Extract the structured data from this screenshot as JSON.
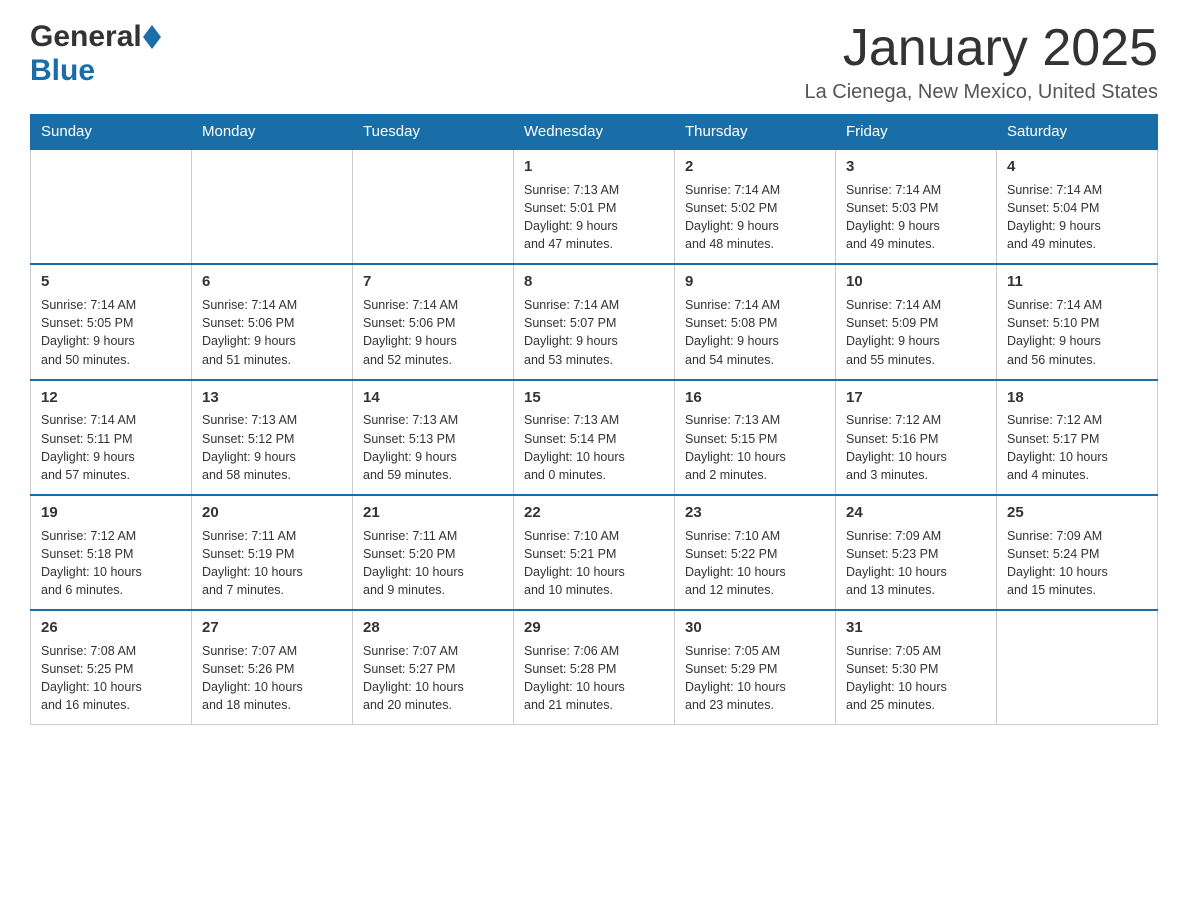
{
  "header": {
    "logo_general": "General",
    "logo_blue": "Blue",
    "logo_tagline": "Blue",
    "month_title": "January 2025",
    "location": "La Cienega, New Mexico, United States"
  },
  "weekdays": [
    "Sunday",
    "Monday",
    "Tuesday",
    "Wednesday",
    "Thursday",
    "Friday",
    "Saturday"
  ],
  "weeks": [
    [
      {
        "day": "",
        "info": ""
      },
      {
        "day": "",
        "info": ""
      },
      {
        "day": "",
        "info": ""
      },
      {
        "day": "1",
        "info": "Sunrise: 7:13 AM\nSunset: 5:01 PM\nDaylight: 9 hours\nand 47 minutes."
      },
      {
        "day": "2",
        "info": "Sunrise: 7:14 AM\nSunset: 5:02 PM\nDaylight: 9 hours\nand 48 minutes."
      },
      {
        "day": "3",
        "info": "Sunrise: 7:14 AM\nSunset: 5:03 PM\nDaylight: 9 hours\nand 49 minutes."
      },
      {
        "day": "4",
        "info": "Sunrise: 7:14 AM\nSunset: 5:04 PM\nDaylight: 9 hours\nand 49 minutes."
      }
    ],
    [
      {
        "day": "5",
        "info": "Sunrise: 7:14 AM\nSunset: 5:05 PM\nDaylight: 9 hours\nand 50 minutes."
      },
      {
        "day": "6",
        "info": "Sunrise: 7:14 AM\nSunset: 5:06 PM\nDaylight: 9 hours\nand 51 minutes."
      },
      {
        "day": "7",
        "info": "Sunrise: 7:14 AM\nSunset: 5:06 PM\nDaylight: 9 hours\nand 52 minutes."
      },
      {
        "day": "8",
        "info": "Sunrise: 7:14 AM\nSunset: 5:07 PM\nDaylight: 9 hours\nand 53 minutes."
      },
      {
        "day": "9",
        "info": "Sunrise: 7:14 AM\nSunset: 5:08 PM\nDaylight: 9 hours\nand 54 minutes."
      },
      {
        "day": "10",
        "info": "Sunrise: 7:14 AM\nSunset: 5:09 PM\nDaylight: 9 hours\nand 55 minutes."
      },
      {
        "day": "11",
        "info": "Sunrise: 7:14 AM\nSunset: 5:10 PM\nDaylight: 9 hours\nand 56 minutes."
      }
    ],
    [
      {
        "day": "12",
        "info": "Sunrise: 7:14 AM\nSunset: 5:11 PM\nDaylight: 9 hours\nand 57 minutes."
      },
      {
        "day": "13",
        "info": "Sunrise: 7:13 AM\nSunset: 5:12 PM\nDaylight: 9 hours\nand 58 minutes."
      },
      {
        "day": "14",
        "info": "Sunrise: 7:13 AM\nSunset: 5:13 PM\nDaylight: 9 hours\nand 59 minutes."
      },
      {
        "day": "15",
        "info": "Sunrise: 7:13 AM\nSunset: 5:14 PM\nDaylight: 10 hours\nand 0 minutes."
      },
      {
        "day": "16",
        "info": "Sunrise: 7:13 AM\nSunset: 5:15 PM\nDaylight: 10 hours\nand 2 minutes."
      },
      {
        "day": "17",
        "info": "Sunrise: 7:12 AM\nSunset: 5:16 PM\nDaylight: 10 hours\nand 3 minutes."
      },
      {
        "day": "18",
        "info": "Sunrise: 7:12 AM\nSunset: 5:17 PM\nDaylight: 10 hours\nand 4 minutes."
      }
    ],
    [
      {
        "day": "19",
        "info": "Sunrise: 7:12 AM\nSunset: 5:18 PM\nDaylight: 10 hours\nand 6 minutes."
      },
      {
        "day": "20",
        "info": "Sunrise: 7:11 AM\nSunset: 5:19 PM\nDaylight: 10 hours\nand 7 minutes."
      },
      {
        "day": "21",
        "info": "Sunrise: 7:11 AM\nSunset: 5:20 PM\nDaylight: 10 hours\nand 9 minutes."
      },
      {
        "day": "22",
        "info": "Sunrise: 7:10 AM\nSunset: 5:21 PM\nDaylight: 10 hours\nand 10 minutes."
      },
      {
        "day": "23",
        "info": "Sunrise: 7:10 AM\nSunset: 5:22 PM\nDaylight: 10 hours\nand 12 minutes."
      },
      {
        "day": "24",
        "info": "Sunrise: 7:09 AM\nSunset: 5:23 PM\nDaylight: 10 hours\nand 13 minutes."
      },
      {
        "day": "25",
        "info": "Sunrise: 7:09 AM\nSunset: 5:24 PM\nDaylight: 10 hours\nand 15 minutes."
      }
    ],
    [
      {
        "day": "26",
        "info": "Sunrise: 7:08 AM\nSunset: 5:25 PM\nDaylight: 10 hours\nand 16 minutes."
      },
      {
        "day": "27",
        "info": "Sunrise: 7:07 AM\nSunset: 5:26 PM\nDaylight: 10 hours\nand 18 minutes."
      },
      {
        "day": "28",
        "info": "Sunrise: 7:07 AM\nSunset: 5:27 PM\nDaylight: 10 hours\nand 20 minutes."
      },
      {
        "day": "29",
        "info": "Sunrise: 7:06 AM\nSunset: 5:28 PM\nDaylight: 10 hours\nand 21 minutes."
      },
      {
        "day": "30",
        "info": "Sunrise: 7:05 AM\nSunset: 5:29 PM\nDaylight: 10 hours\nand 23 minutes."
      },
      {
        "day": "31",
        "info": "Sunrise: 7:05 AM\nSunset: 5:30 PM\nDaylight: 10 hours\nand 25 minutes."
      },
      {
        "day": "",
        "info": ""
      }
    ]
  ]
}
